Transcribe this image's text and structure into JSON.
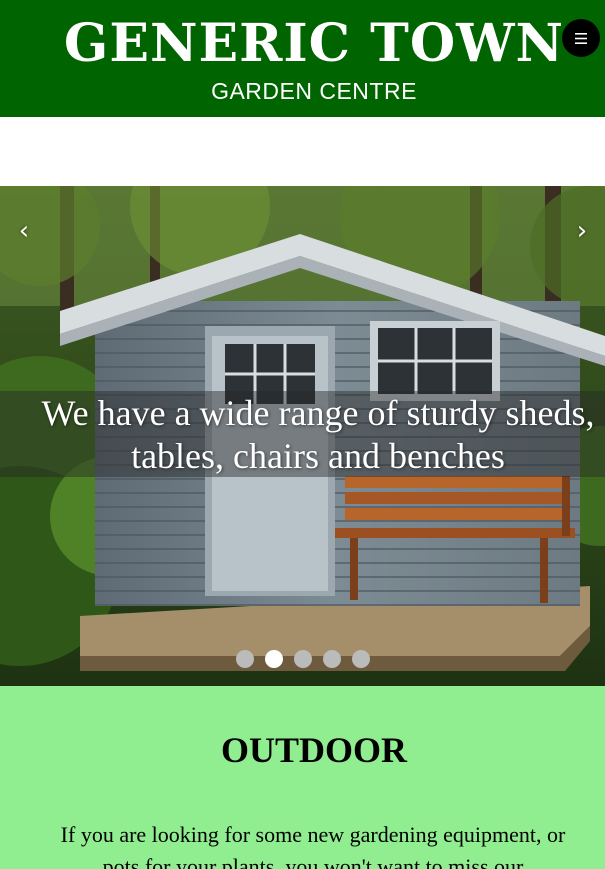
{
  "header": {
    "title": "GENERIC TOWN",
    "subtitle": "GARDEN CENTRE",
    "menu_icon": "hamburger-icon",
    "background_color": "#006400"
  },
  "slideshow": {
    "caption": "We have a wide range of sturdy sheds, tables, chairs and benches",
    "prev_icon": "chevron-left-icon",
    "next_icon": "chevron-right-icon",
    "prev_label": "‹",
    "next_label": "›",
    "slide_count": 5,
    "active_slide": 2
  },
  "section": {
    "heading": "OUTDOOR",
    "text": "If you are looking for some new gardening equipment, or pots for your plants, you won't want to miss our",
    "background_color": "#90ee90"
  }
}
